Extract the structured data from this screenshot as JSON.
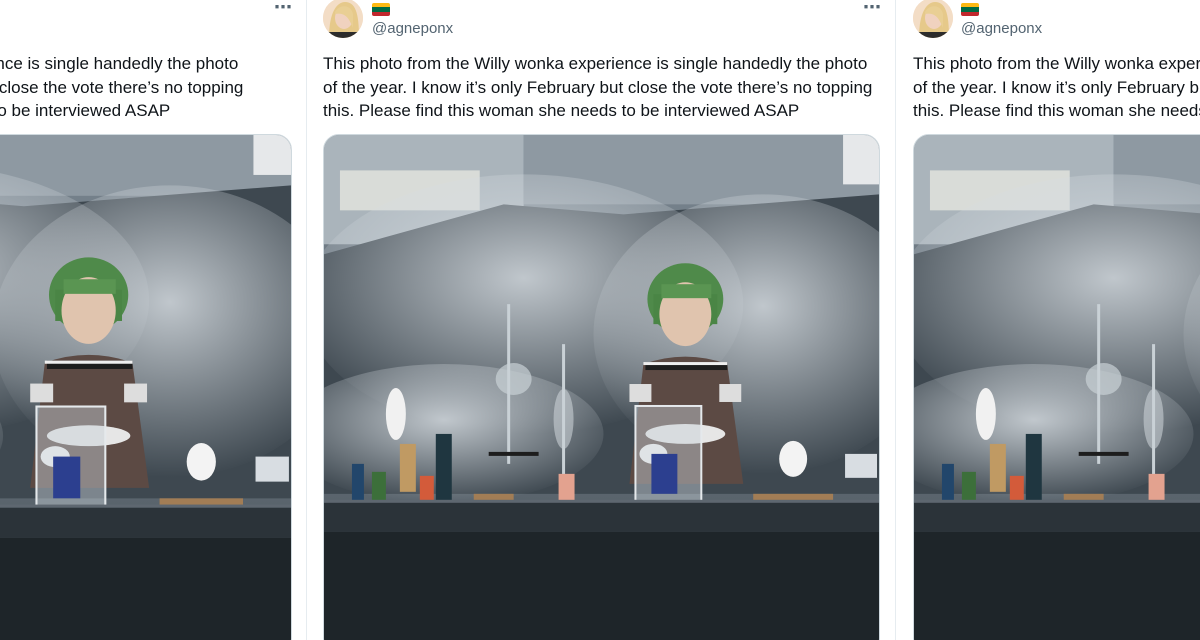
{
  "tweets": [
    {
      "handle": "@agneponx",
      "more_icon": "⋯",
      "lines": [
        "This photo from the Willy wonka experience is single handedly the photo",
        "of the year. I know it’s only February but close the vote there’s no topping",
        "this. Please find this woman she needs to be interviewed ASAP"
      ]
    }
  ],
  "colors": {
    "text": "#0f1419",
    "secondary": "#536471",
    "border": "#cfd9de",
    "flag_yellow": "#fdb913",
    "flag_green": "#006a44",
    "flag_red": "#c1272d"
  },
  "icons": {
    "more": "more-horizontal-icon",
    "flag": "lithuania-flag-icon",
    "avatar": "user-avatar"
  },
  "media": {
    "description_icon": "photo-image"
  }
}
